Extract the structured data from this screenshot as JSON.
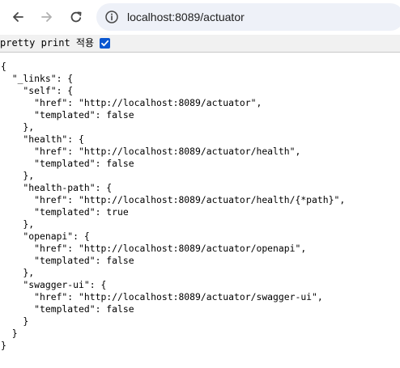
{
  "browser": {
    "url": "localhost:8089/actuator",
    "icons": {
      "back": "arrow-left-icon",
      "forward": "arrow-right-icon",
      "reload": "reload-icon",
      "site_info": "info-icon"
    }
  },
  "pretty_print": {
    "label": "pretty print 적용",
    "checked": true
  },
  "json_lines": [
    "{",
    "  \"_links\": {",
    "    \"self\": {",
    "      \"href\": \"http://localhost:8089/actuator\",",
    "      \"templated\": false",
    "    },",
    "    \"health\": {",
    "      \"href\": \"http://localhost:8089/actuator/health\",",
    "      \"templated\": false",
    "    },",
    "    \"health-path\": {",
    "      \"href\": \"http://localhost:8089/actuator/health/{*path}\",",
    "      \"templated\": true",
    "    },",
    "    \"openapi\": {",
    "      \"href\": \"http://localhost:8089/actuator/openapi\",",
    "      \"templated\": false",
    "    },",
    "    \"swagger-ui\": {",
    "      \"href\": \"http://localhost:8089/actuator/swagger-ui\",",
    "      \"templated\": false",
    "    }",
    "  }",
    "}"
  ]
}
